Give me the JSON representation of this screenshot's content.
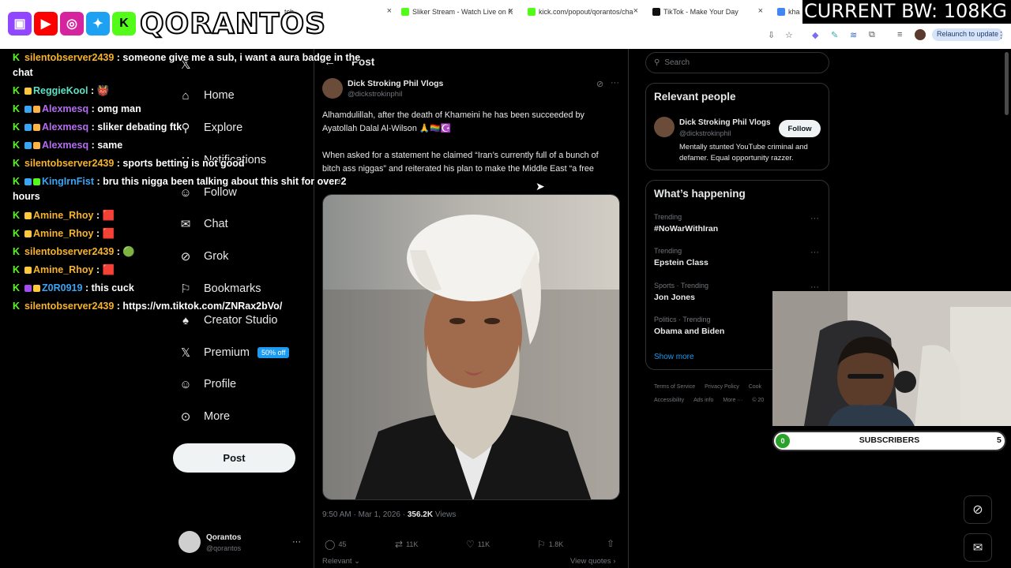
{
  "browser": {
    "tabs": [
      {
        "label": "tch",
        "favicon_color": "#9146ff"
      },
      {
        "label": "Sliker Stream - Watch Live on K",
        "favicon_color": "#53fc18"
      },
      {
        "label": "kick.com/popout/qorantos/cha",
        "favicon_color": "#53fc18"
      },
      {
        "label": "TikTok - Make Your Day",
        "favicon_color": "#111111"
      },
      {
        "label": "kha",
        "favicon_color": "#4285f4"
      }
    ],
    "relaunch_label": "Relaunch to update"
  },
  "overlay": {
    "brand": "QORANTOS",
    "bandwidth": "CURRENT BW: 108KG"
  },
  "chat": [
    {
      "user": "silentobserver2439",
      "color": "#f7b32b",
      "msg": "someone give me a sub, i want a aura badge in the",
      "cont": "chat"
    },
    {
      "user": "ReggieKool",
      "color": "#5ce1c5",
      "msg": "👹"
    },
    {
      "user": "Alexmesq",
      "color": "#b46cf0",
      "msg": "omg man"
    },
    {
      "user": "Alexmesq",
      "color": "#b46cf0",
      "msg": "sliker debating ftk"
    },
    {
      "user": "Alexmesq",
      "color": "#b46cf0",
      "msg": "same"
    },
    {
      "user": "silentobserver2439",
      "color": "#f7b32b",
      "msg": "sports betting is not good"
    },
    {
      "user": "KingIrnFist",
      "color": "#39a6f5",
      "msg": "bru this nigga been talking about this shit for over 2",
      "cont": "hours"
    },
    {
      "user": "Amine_Rhoy",
      "color": "#f7b32b",
      "msg": "🟥"
    },
    {
      "user": "Amine_Rhoy",
      "color": "#f7b32b",
      "msg": "🟥"
    },
    {
      "user": "silentobserver2439",
      "color": "#f7b32b",
      "msg": "🟢"
    },
    {
      "user": "Amine_Rhoy",
      "color": "#f7b32b",
      "msg": "🟥"
    },
    {
      "user": "Z0R0919",
      "color": "#39a6f5",
      "msg": "this cuck"
    },
    {
      "user": "silentobserver2439",
      "color": "#f7b32b",
      "msg": "https://vm.tiktok.com/ZNRax2bVo/"
    }
  ],
  "nav": {
    "items": [
      {
        "label": "Home",
        "icon": "home-icon",
        "glyph": "⌂"
      },
      {
        "label": "Explore",
        "icon": "search-icon",
        "glyph": "⚲"
      },
      {
        "label": "Notifications",
        "icon": "bell-icon",
        "glyph": "∷"
      },
      {
        "label": "Follow",
        "icon": "person-plus-icon",
        "glyph": "☺"
      },
      {
        "label": "Chat",
        "icon": "mail-icon",
        "glyph": "✉"
      },
      {
        "label": "Grok",
        "icon": "grok-icon",
        "glyph": "⊘"
      },
      {
        "label": "Bookmarks",
        "icon": "bookmark-icon",
        "glyph": "⚐"
      },
      {
        "label": "Creator Studio",
        "icon": "creator-studio-icon",
        "glyph": "♠"
      },
      {
        "label": "Premium",
        "icon": "x-logo-icon",
        "glyph": "𝕏"
      },
      {
        "label": "Profile",
        "icon": "profile-icon",
        "glyph": "☺"
      },
      {
        "label": "More",
        "icon": "more-circle-icon",
        "glyph": "⊙"
      }
    ],
    "premium_badge": "50% off",
    "post_button": "Post",
    "account_name": "Qorantos",
    "account_handle": "@qorantos"
  },
  "post": {
    "header_title": "Post",
    "author_name": "Dick Stroking Phil Vlogs",
    "author_handle": "@dickstrokinphil",
    "text1": "Alhamdulillah, after the death of Khameini he has been succeeded by Ayatollah Dalal Al-Wilson 🙏🏳️‍🌈☪️",
    "text2": "When asked for a statement he claimed “Iran’s currently full of a bunch of bitch ass niggas” and reiterated his plan to make the Middle East “a free zone”",
    "timestamp": "9:50 AM · Mar 1, 2026 ·",
    "views_count": "356.2K",
    "views_label": "Views",
    "replies": "45",
    "reposts": "11K",
    "likes": "11K",
    "bookmarks": "1.8K",
    "relevant": "Relevant",
    "view_quotes": "View quotes"
  },
  "sidebar": {
    "search_placeholder": "Search",
    "relevant_title": "Relevant people",
    "person_name": "Dick Stroking Phil Vlogs",
    "person_handle": "@dickstrokinphil",
    "follow": "Follow",
    "person_bio": "Mentally stunted YouTube criminal and defamer. Equal opportunity razzer.",
    "happening_title": "What’s happening",
    "trends": [
      {
        "context": "Trending",
        "name": "#NoWarWithIran"
      },
      {
        "context": "Trending",
        "name": "Epstein Class"
      },
      {
        "context": "Sports · Trending",
        "name": "Jon Jones"
      },
      {
        "context": "Politics · Trending",
        "name": "Obama and Biden"
      }
    ],
    "show_more": "Show more",
    "footer1": [
      "Terms of Service",
      "Privacy Policy",
      "Cook"
    ],
    "footer2": [
      "Accessibility",
      "Ads info",
      "More ···",
      "© 20"
    ]
  },
  "subs_bar": {
    "start": "0",
    "label": "SUBSCRIBERS",
    "goal": "5",
    "progress": 0
  }
}
